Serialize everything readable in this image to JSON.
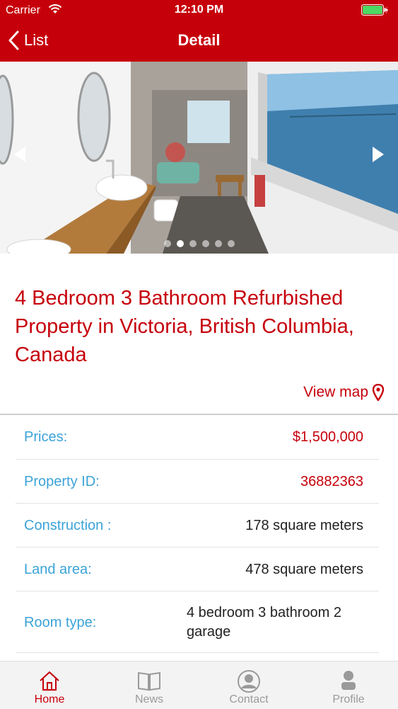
{
  "status_bar": {
    "carrier": "Carrier",
    "time": "12:10 PM"
  },
  "nav": {
    "back_label": "List",
    "title": "Detail"
  },
  "carousel": {
    "slide_count": 6,
    "active_index": 1
  },
  "property": {
    "title": "4 Bedroom 3 Bathroom Refurbished Property in Victoria, British Columbia, Canada",
    "view_map_label": "View map"
  },
  "details": [
    {
      "label": "Prices:",
      "value": "$1,500,000",
      "accent": true
    },
    {
      "label": "Property ID:",
      "value": "36882363",
      "accent": true
    },
    {
      "label": "Construction :",
      "value": "178 square meters",
      "accent": false
    },
    {
      "label": "Land area:",
      "value": "478 square meters",
      "accent": false
    },
    {
      "label": "Room type:",
      "value": "4 bedroom 3 bathroom 2 garage",
      "accent": false
    }
  ],
  "tabbar": {
    "home": "Home",
    "news": "News",
    "contact": "Contact",
    "profile": "Profile",
    "active": "home"
  },
  "colors": {
    "brand_red": "#c6000b",
    "label_blue": "#3ba3d8",
    "battery_green": "#4cd964"
  },
  "icons": [
    "wifi-icon",
    "battery-icon",
    "back-chevron-icon",
    "map-pin-icon",
    "home-icon",
    "news-book-icon",
    "contact-user-icon",
    "profile-user-icon"
  ]
}
